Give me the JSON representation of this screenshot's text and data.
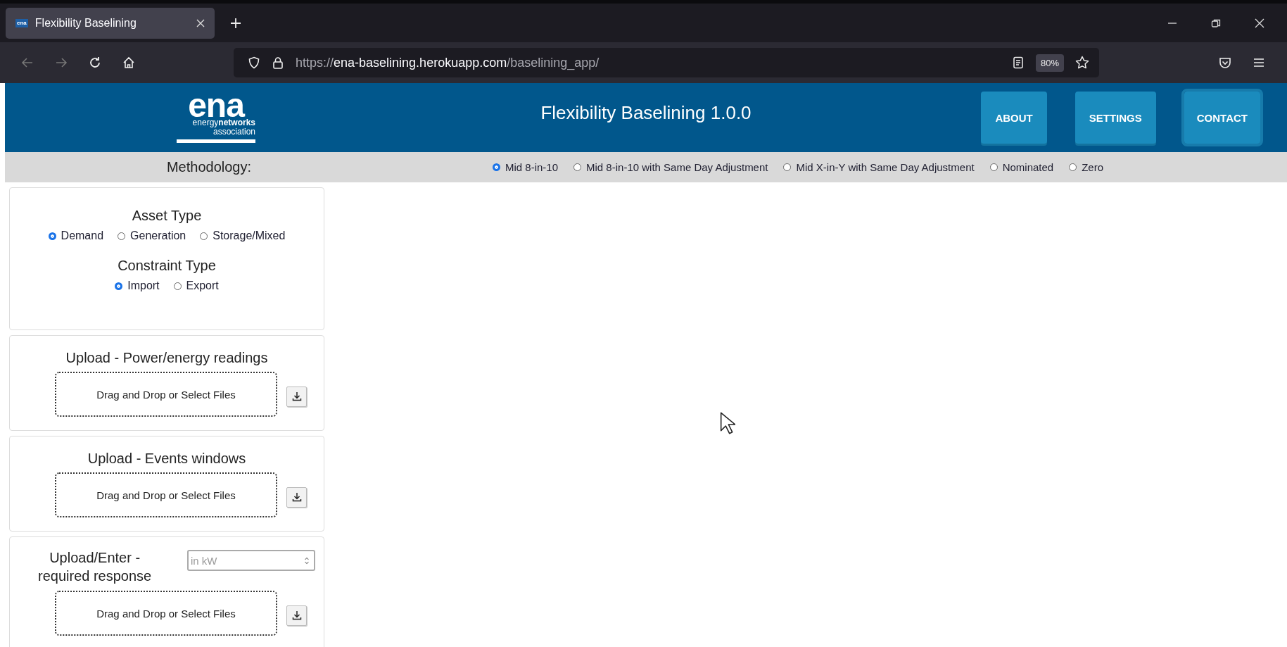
{
  "browser": {
    "tab": {
      "favicon_text": "ena",
      "title": "Flexibility Baselining"
    },
    "url": {
      "scheme": "https://",
      "host": "ena-baselining.herokuapp.com",
      "path": "/baselining_app/"
    },
    "zoom": "80%"
  },
  "header": {
    "logo": {
      "word": "ena",
      "line1_light": "energy",
      "line1_bold": "networks",
      "line2": "association"
    },
    "title": "Flexibility Baselining 1.0.0",
    "buttons": [
      {
        "label": "ABOUT",
        "focused": false
      },
      {
        "label": "SETTINGS",
        "focused": false
      },
      {
        "label": "CONTACT",
        "focused": true
      }
    ]
  },
  "methodology": {
    "label": "Methodology:",
    "options": [
      {
        "label": "Mid 8-in-10",
        "selected": true
      },
      {
        "label": "Mid 8-in-10 with Same Day Adjustment",
        "selected": false
      },
      {
        "label": "Mid X-in-Y with Same Day Adjustment",
        "selected": false
      },
      {
        "label": "Nominated",
        "selected": false
      },
      {
        "label": "Zero",
        "selected": false
      }
    ]
  },
  "settings_panel": {
    "groups": [
      {
        "title": "Asset Type",
        "options": [
          {
            "label": "Demand",
            "selected": true
          },
          {
            "label": "Generation",
            "selected": false
          },
          {
            "label": "Storage/Mixed",
            "selected": false
          }
        ]
      },
      {
        "title": "Constraint Type",
        "options": [
          {
            "label": "Import",
            "selected": true
          },
          {
            "label": "Export",
            "selected": false
          }
        ]
      }
    ]
  },
  "uploads": [
    {
      "kind": "upload",
      "title": "Upload - Power/energy readings",
      "dropzone": "Drag and Drop or Select Files"
    },
    {
      "kind": "upload",
      "title": "Upload - Events windows",
      "dropzone": "Drag and Drop or Select Files"
    },
    {
      "kind": "upload_with_input",
      "title_line1": "Upload/Enter -",
      "title_line2": "required response",
      "placeholder": "in kW",
      "dropzone": "Drag and Drop or Select Files"
    }
  ]
}
